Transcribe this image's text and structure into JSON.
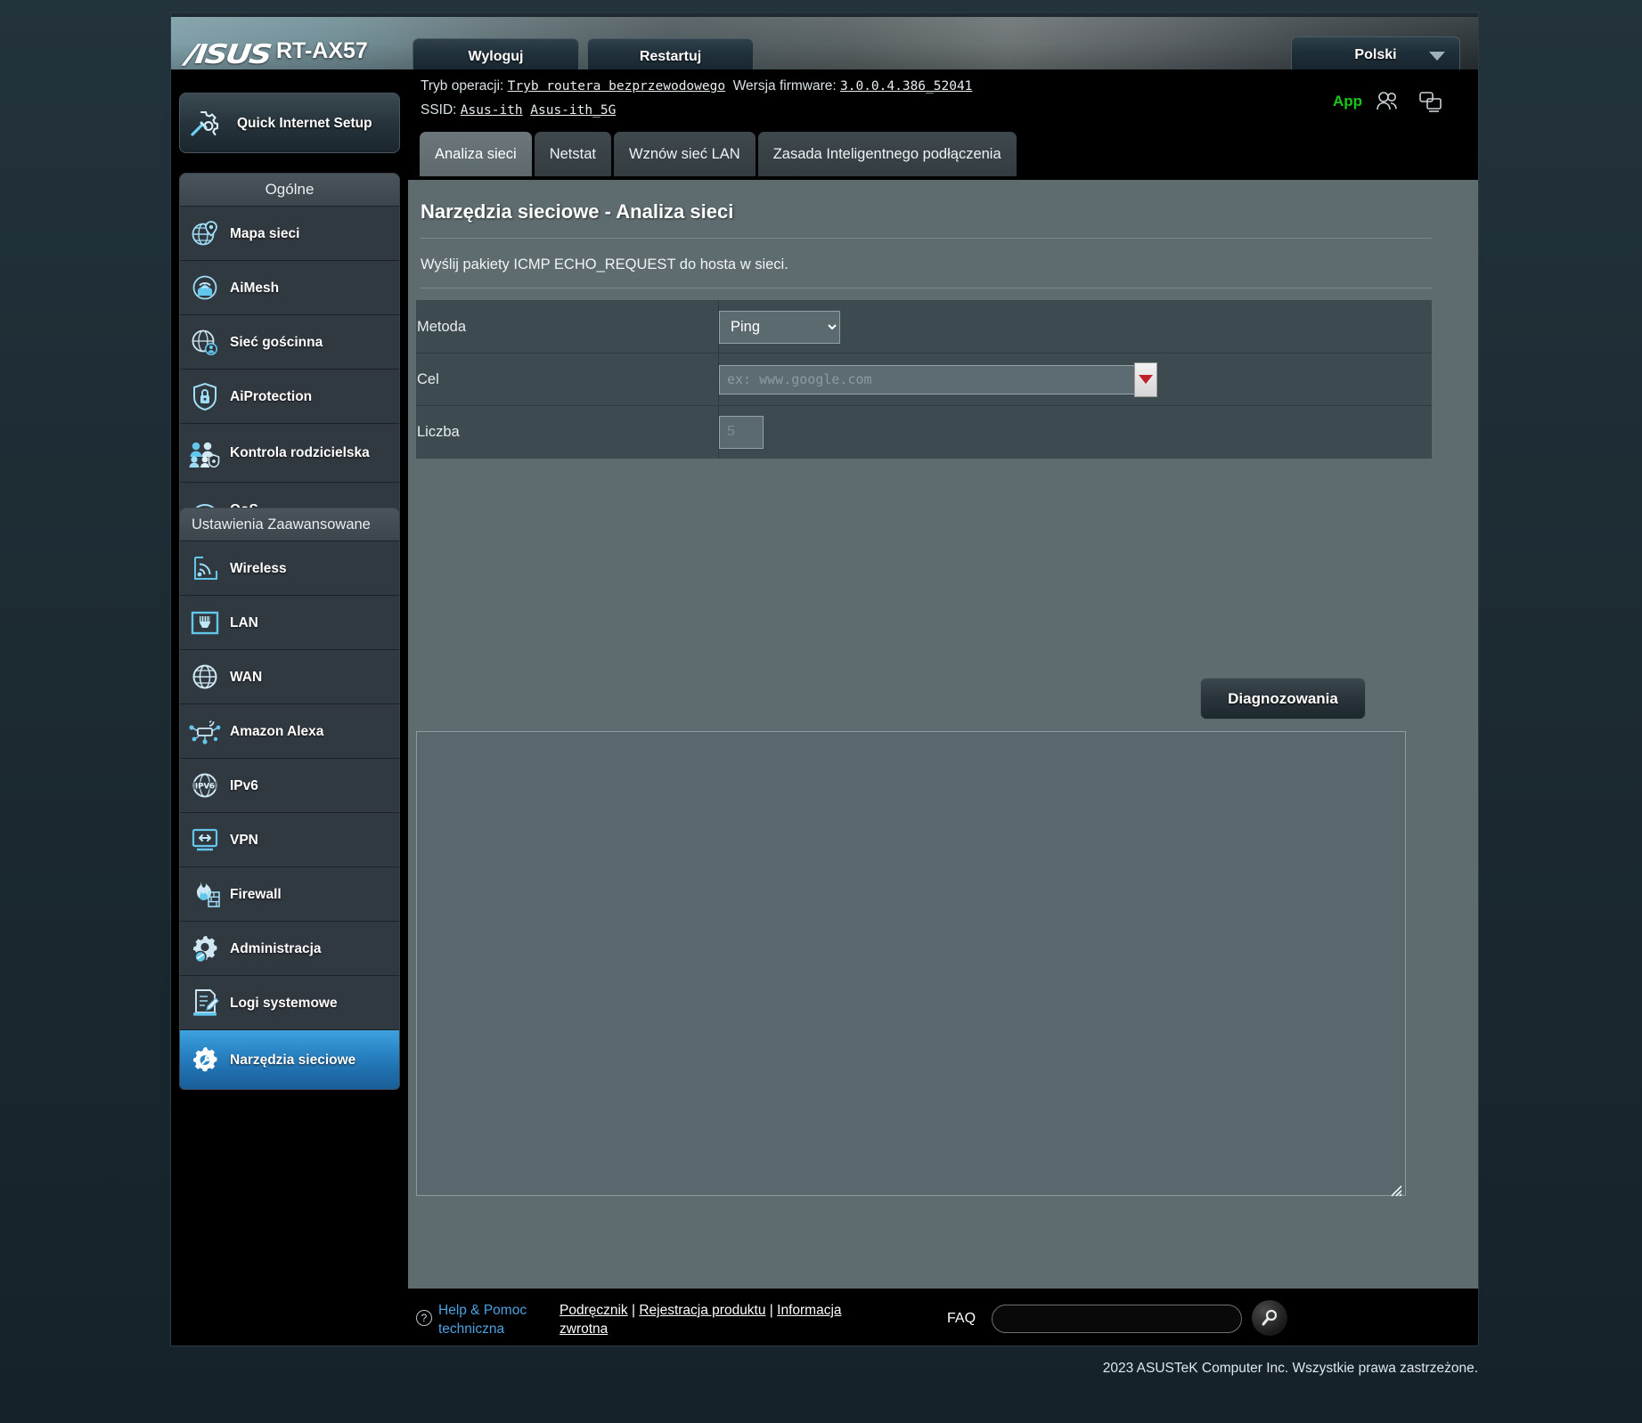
{
  "header": {
    "brand": "/ISUS",
    "model": "RT-AX57",
    "logout_label": "Wyloguj",
    "restart_label": "Restartuj",
    "language": "Polski"
  },
  "info": {
    "op_mode_label": "Tryb operacji:",
    "op_mode_value": "Tryb routera bezprzewodowego",
    "firmware_label": "Wersja firmware:",
    "firmware_value": "3.0.0.4.386_52041",
    "ssid_label": "SSID:",
    "ssid_1": "Asus-ith",
    "ssid_2": "Asus-ith_5G",
    "app_label": "App"
  },
  "sidebar": {
    "quick_setup": "Quick Internet Setup",
    "general_header": "Ogólne",
    "general_items": [
      {
        "label": "Mapa sieci",
        "icon": "network-map-icon"
      },
      {
        "label": "AiMesh",
        "icon": "aimesh-icon"
      },
      {
        "label": "Sieć gościnna",
        "icon": "guest-network-icon"
      },
      {
        "label": "AiProtection",
        "icon": "shield-lock-icon"
      },
      {
        "label": "Kontrola rodzicielska",
        "icon": "parental-control-icon"
      },
      {
        "label": "QoS",
        "icon": "qos-gauge-icon"
      }
    ],
    "advanced_header": "Ustawienia Zaawansowane",
    "advanced_items": [
      {
        "label": "Wireless",
        "icon": "wireless-icon"
      },
      {
        "label": "LAN",
        "icon": "lan-port-icon"
      },
      {
        "label": "WAN",
        "icon": "globe-icon"
      },
      {
        "label": "Amazon Alexa",
        "icon": "alexa-icon"
      },
      {
        "label": "IPv6",
        "icon": "ipv6-icon"
      },
      {
        "label": "VPN",
        "icon": "vpn-monitor-icon"
      },
      {
        "label": "Firewall",
        "icon": "firewall-flame-icon"
      },
      {
        "label": "Administracja",
        "icon": "administration-gear-icon"
      },
      {
        "label": "Logi systemowe",
        "icon": "system-log-icon"
      },
      {
        "label": "Narzędzia sieciowe",
        "icon": "network-tools-icon",
        "selected": true
      }
    ]
  },
  "tabs": [
    {
      "label": "Analiza sieci",
      "active": true
    },
    {
      "label": "Netstat",
      "active": false
    },
    {
      "label": "Wznów sieć LAN",
      "active": false
    },
    {
      "label": "Zasada Inteligentnego podłączenia",
      "active": false
    }
  ],
  "panel": {
    "title": "Narzędzia sieciowe - Analiza sieci",
    "description": "Wyślij pakiety ICMP ECHO_REQUEST do hosta w sieci.",
    "fields": {
      "method_label": "Metoda",
      "method_value": "Ping",
      "method_options": [
        "Ping"
      ],
      "target_label": "Cel",
      "target_value": "",
      "target_placeholder": "ex: www.google.com",
      "count_label": "Liczba",
      "count_value": "",
      "count_placeholder": "5"
    },
    "diagnose_label": "Diagnozowania",
    "result_value": ""
  },
  "footer": {
    "help_text": "Help & Pomoc techniczna",
    "link_manual": "Podręcznik",
    "link_registration": "Rejestracja produktu",
    "link_feedback": "Informacja zwrotna",
    "separator": " | ",
    "faq_label": "FAQ",
    "faq_value": "",
    "copyright": "2023 ASUSTeK Computer Inc. Wszystkie prawa zastrzeżone."
  }
}
